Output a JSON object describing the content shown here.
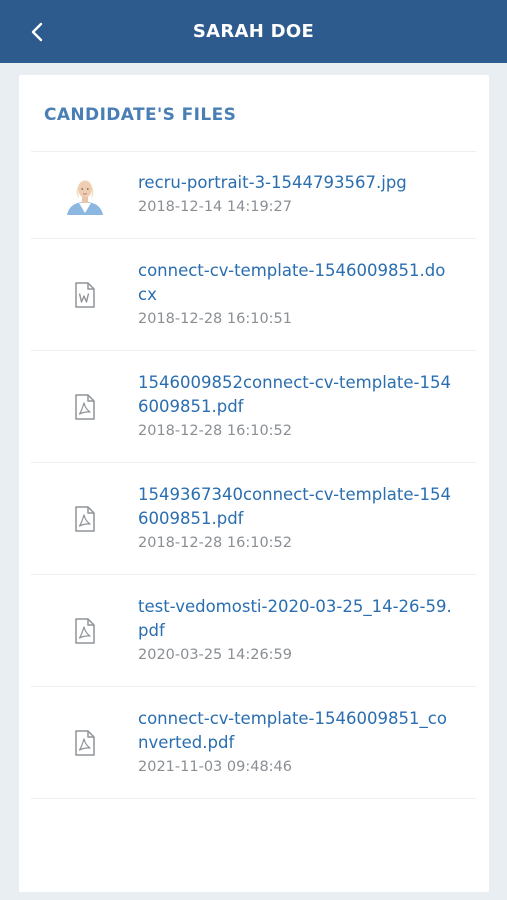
{
  "header": {
    "title": "SARAH DOE",
    "back_icon": "chevron-left-icon",
    "background": "#2e5b8e"
  },
  "section": {
    "title": "CANDIDATE'S FILES"
  },
  "files": [
    {
      "name": "recru-portrait-3-1544793567.jpg",
      "date": "2018-12-14 14:19:27",
      "icon": "photo-thumbnail"
    },
    {
      "name": "connect-cv-template-1546009851.docx",
      "date": "2018-12-28 16:10:51",
      "icon": "word-doc-icon"
    },
    {
      "name": "1546009852connect-cv-template-1546009851.pdf",
      "date": "2018-12-28 16:10:52",
      "icon": "pdf-icon"
    },
    {
      "name": "1549367340connect-cv-template-1546009851.pdf",
      "date": "2018-12-28 16:10:52",
      "icon": "pdf-icon"
    },
    {
      "name": "test-vedomosti-2020-03-25_14-26-59.pdf",
      "date": "2020-03-25 14:26:59",
      "icon": "pdf-icon"
    },
    {
      "name": "connect-cv-template-1546009851_converted.pdf",
      "date": "2021-11-03 09:48:46",
      "icon": "pdf-icon"
    }
  ],
  "colors": {
    "link": "#2a6eb0",
    "section_title": "#4a7fb5",
    "muted": "#8a8f94"
  }
}
